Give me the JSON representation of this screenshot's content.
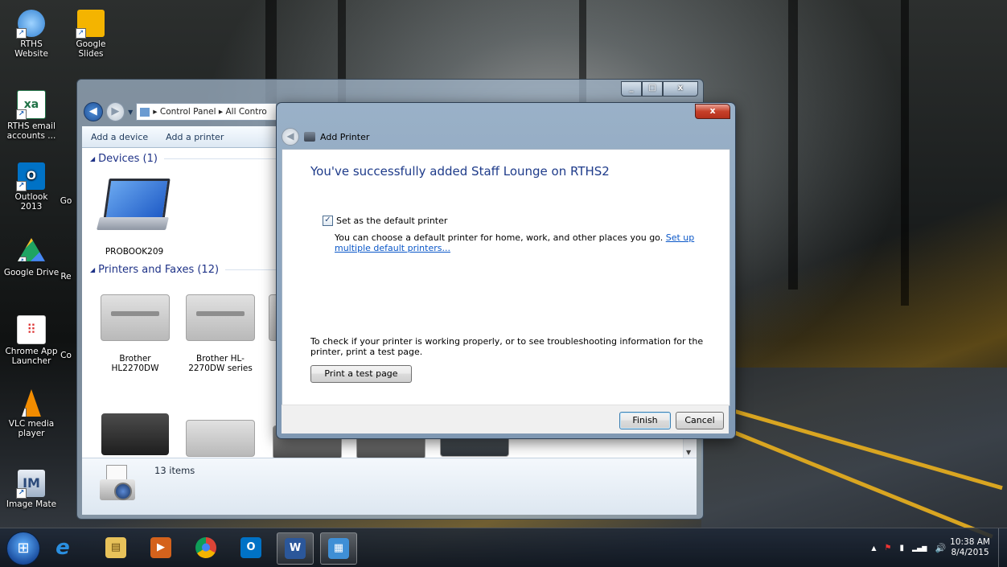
{
  "desktop": {
    "icons": [
      {
        "label": "RTHS Website",
        "icon": "globe-icon",
        "color": "#2f7fd1"
      },
      {
        "label": "Google Slides",
        "icon": "slides-icon",
        "color": "#f4b400"
      },
      {
        "label": "RTHS email accounts ...",
        "icon": "excel-icon",
        "color": "#1e7145"
      },
      {
        "label": "Outlook 2013",
        "icon": "outlook-icon",
        "color": "#0072c6"
      },
      {
        "label": "Google Drive",
        "icon": "drive-icon",
        "color": "#f6c02c"
      },
      {
        "label": "Chrome App Launcher",
        "icon": "app-launcher-icon",
        "color": "#ffffff"
      },
      {
        "label": "VLC media player",
        "icon": "vlc-cone-icon",
        "color": "#f28c00"
      },
      {
        "label": "Image Mate",
        "icon": "imagemate-icon",
        "color": "#2c4a7a"
      }
    ],
    "partial_labels": [
      "Go",
      "Re",
      "Co"
    ]
  },
  "explorer": {
    "breadcrumb": [
      "Control Panel",
      "All Contro"
    ],
    "toolbar": {
      "add_device": "Add a device",
      "add_printer": "Add a printer"
    },
    "groups": {
      "devices": "Devices (1)",
      "printers": "Printers and Faxes (12)"
    },
    "devices": [
      {
        "name": "PROBOOK209"
      }
    ],
    "printers": [
      {
        "name": "Brother HL2270DW"
      },
      {
        "name": "Brother HL-2270DW series"
      }
    ],
    "status": {
      "count": "13 items"
    },
    "window_buttons": {
      "minimize": "_",
      "maximize": "□",
      "close": "x"
    }
  },
  "dialog": {
    "title": "Add Printer",
    "close": "x",
    "heading": "You've successfully added Staff Lounge on RTHS2",
    "default_checkbox": {
      "label": "Set as the default printer",
      "checked": "✓"
    },
    "default_desc": "You can choose a default printer for home, work, and other places you go.",
    "default_link": "Set up multiple default printers...",
    "test_info": "To check if your printer is working properly, or to see troubleshooting information for the printer, print a test page.",
    "buttons": {
      "print_test": "Print a test page",
      "finish": "Finish",
      "cancel": "Cancel"
    }
  },
  "taskbar": {
    "items": [
      {
        "icon": "internet-explorer-icon",
        "glyph": "e",
        "color": "#2a8fe0"
      },
      {
        "icon": "file-explorer-icon",
        "glyph": "▤",
        "color": "#e8c25a"
      },
      {
        "icon": "media-player-icon",
        "glyph": "▶",
        "color": "#d4621c"
      },
      {
        "icon": "chrome-icon",
        "glyph": "●",
        "color": "#db4437"
      },
      {
        "icon": "outlook-icon",
        "glyph": "O",
        "color": "#0072c6"
      },
      {
        "icon": "word-icon",
        "glyph": "W",
        "color": "#2b579a"
      },
      {
        "icon": "control-panel-icon",
        "glyph": "▦",
        "color": "#3f8fd6"
      }
    ],
    "tray": {
      "chevron": "▲",
      "flag": "⚑",
      "battery": "▮",
      "signal": "▂▄▆",
      "volume": "🔊"
    },
    "clock": {
      "time": "10:38 AM",
      "date": "8/4/2015"
    }
  }
}
